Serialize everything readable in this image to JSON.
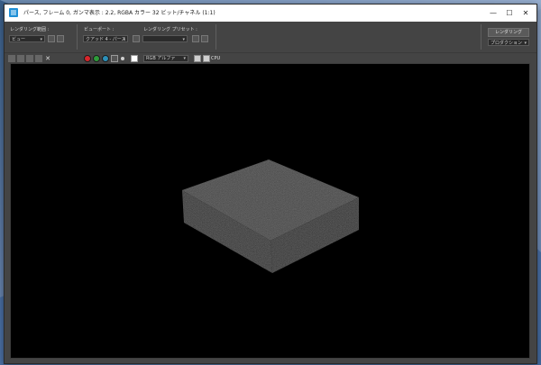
{
  "window": {
    "title": "パース, フレーム 0, ガンマ表示 : 2.2, RGBA カラー 32 ビット/チャネル (1:1)",
    "controls": {
      "minimize": "—",
      "maximize": "☐",
      "close": "✕"
    }
  },
  "toolbar": {
    "render_area": {
      "label": "レンダリング範囲 :",
      "value": "ビュー"
    },
    "viewport": {
      "label": "ビューポート :",
      "value": "クアッド 4 - パース"
    },
    "render_preset": {
      "label": "レンダリング プリセット :",
      "value": ""
    },
    "render_button": "レンダリング",
    "production": {
      "value": "プロダクション"
    }
  },
  "toolbar2": {
    "channel": {
      "value": "RGB アルファ"
    },
    "cpu_label": "CPU"
  },
  "colors": {
    "red_channel": "#d7262b",
    "green_channel": "#2e9c3a",
    "blue_channel": "#2c8fb8",
    "window_bg": "#444444",
    "viewport_bg": "#000000"
  }
}
